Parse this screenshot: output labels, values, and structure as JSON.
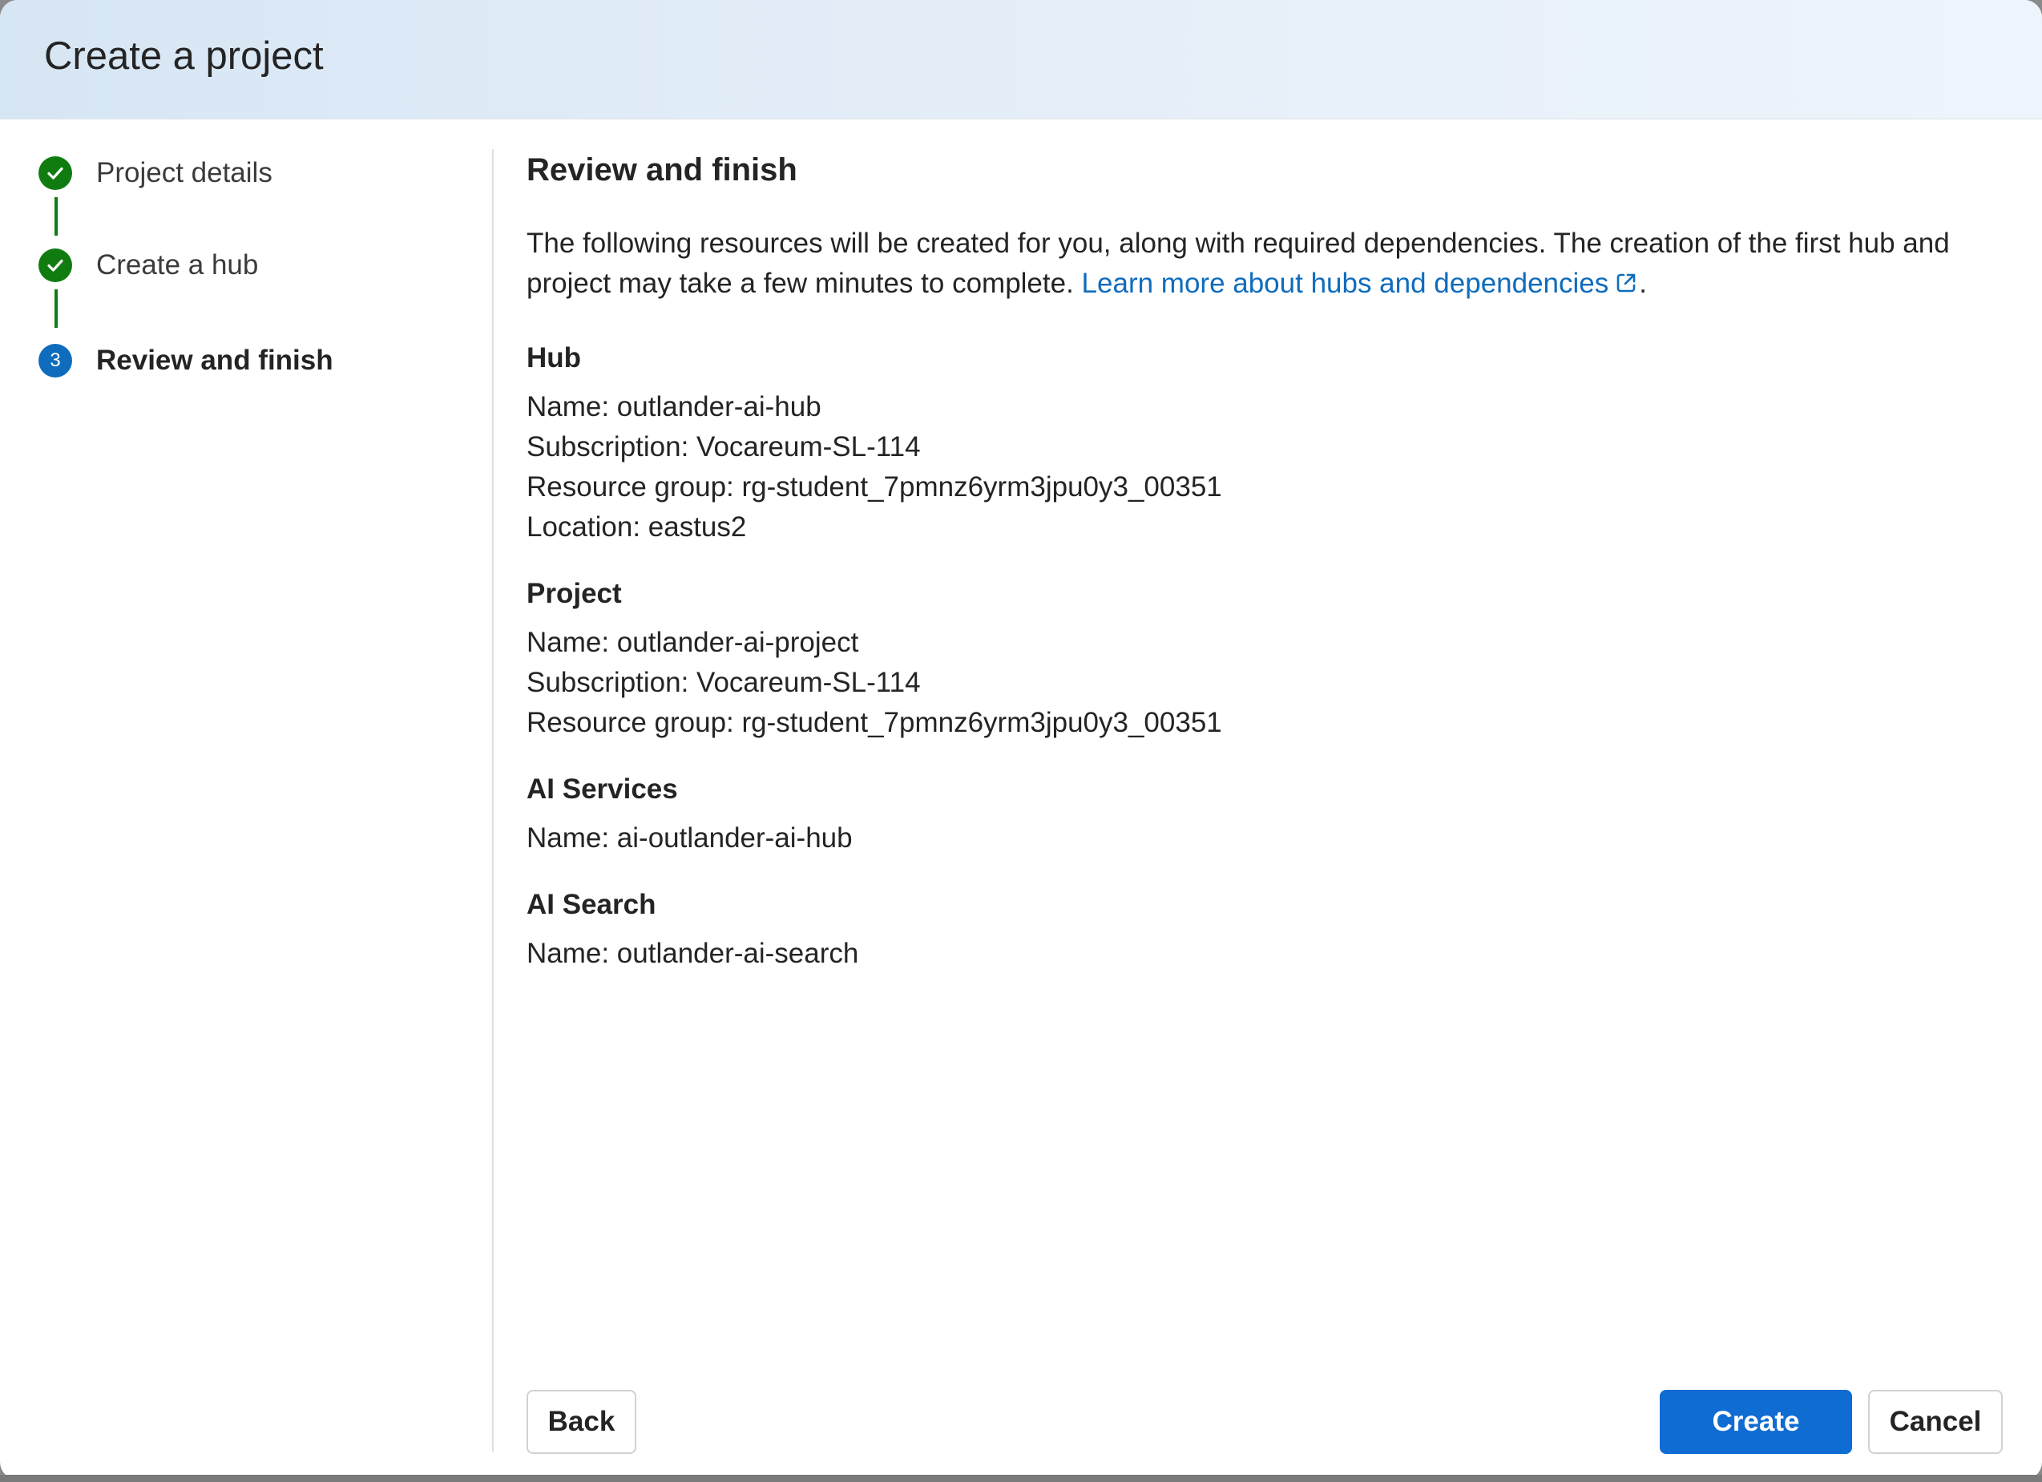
{
  "dialog": {
    "title": "Create a project"
  },
  "stepper": {
    "steps": [
      {
        "label": "Project details",
        "status": "completed"
      },
      {
        "label": "Create a hub",
        "status": "completed"
      },
      {
        "label": "Review and finish",
        "status": "current",
        "number": "3"
      }
    ]
  },
  "content": {
    "title": "Review and finish",
    "description_text": "The following resources will be created for you, along with required dependencies. The creation of the first hub and project may take a few minutes to complete. ",
    "learn_more_link": "Learn more about hubs and dependencies",
    "description_suffix": ".",
    "sections": [
      {
        "title": "Hub",
        "lines": [
          "Name: outlander-ai-hub",
          "Subscription: Vocareum-SL-114",
          "Resource group: rg-student_7pmnz6yrm3jpu0y3_00351",
          "Location: eastus2"
        ]
      },
      {
        "title": "Project",
        "lines": [
          "Name: outlander-ai-project",
          "Subscription: Vocareum-SL-114",
          "Resource group: rg-student_7pmnz6yrm3jpu0y3_00351"
        ]
      },
      {
        "title": "AI Services",
        "lines": [
          "Name: ai-outlander-ai-hub"
        ]
      },
      {
        "title": "AI Search",
        "lines": [
          "Name: outlander-ai-search"
        ]
      }
    ]
  },
  "footer": {
    "back_label": "Back",
    "create_label": "Create",
    "cancel_label": "Cancel"
  },
  "colors": {
    "accent": "#0f6cbd",
    "success": "#107c10",
    "primary_button": "#0f6cd2"
  },
  "icons": {
    "completed_step": "checkmark-circle-icon",
    "external_link": "open-external-icon"
  }
}
